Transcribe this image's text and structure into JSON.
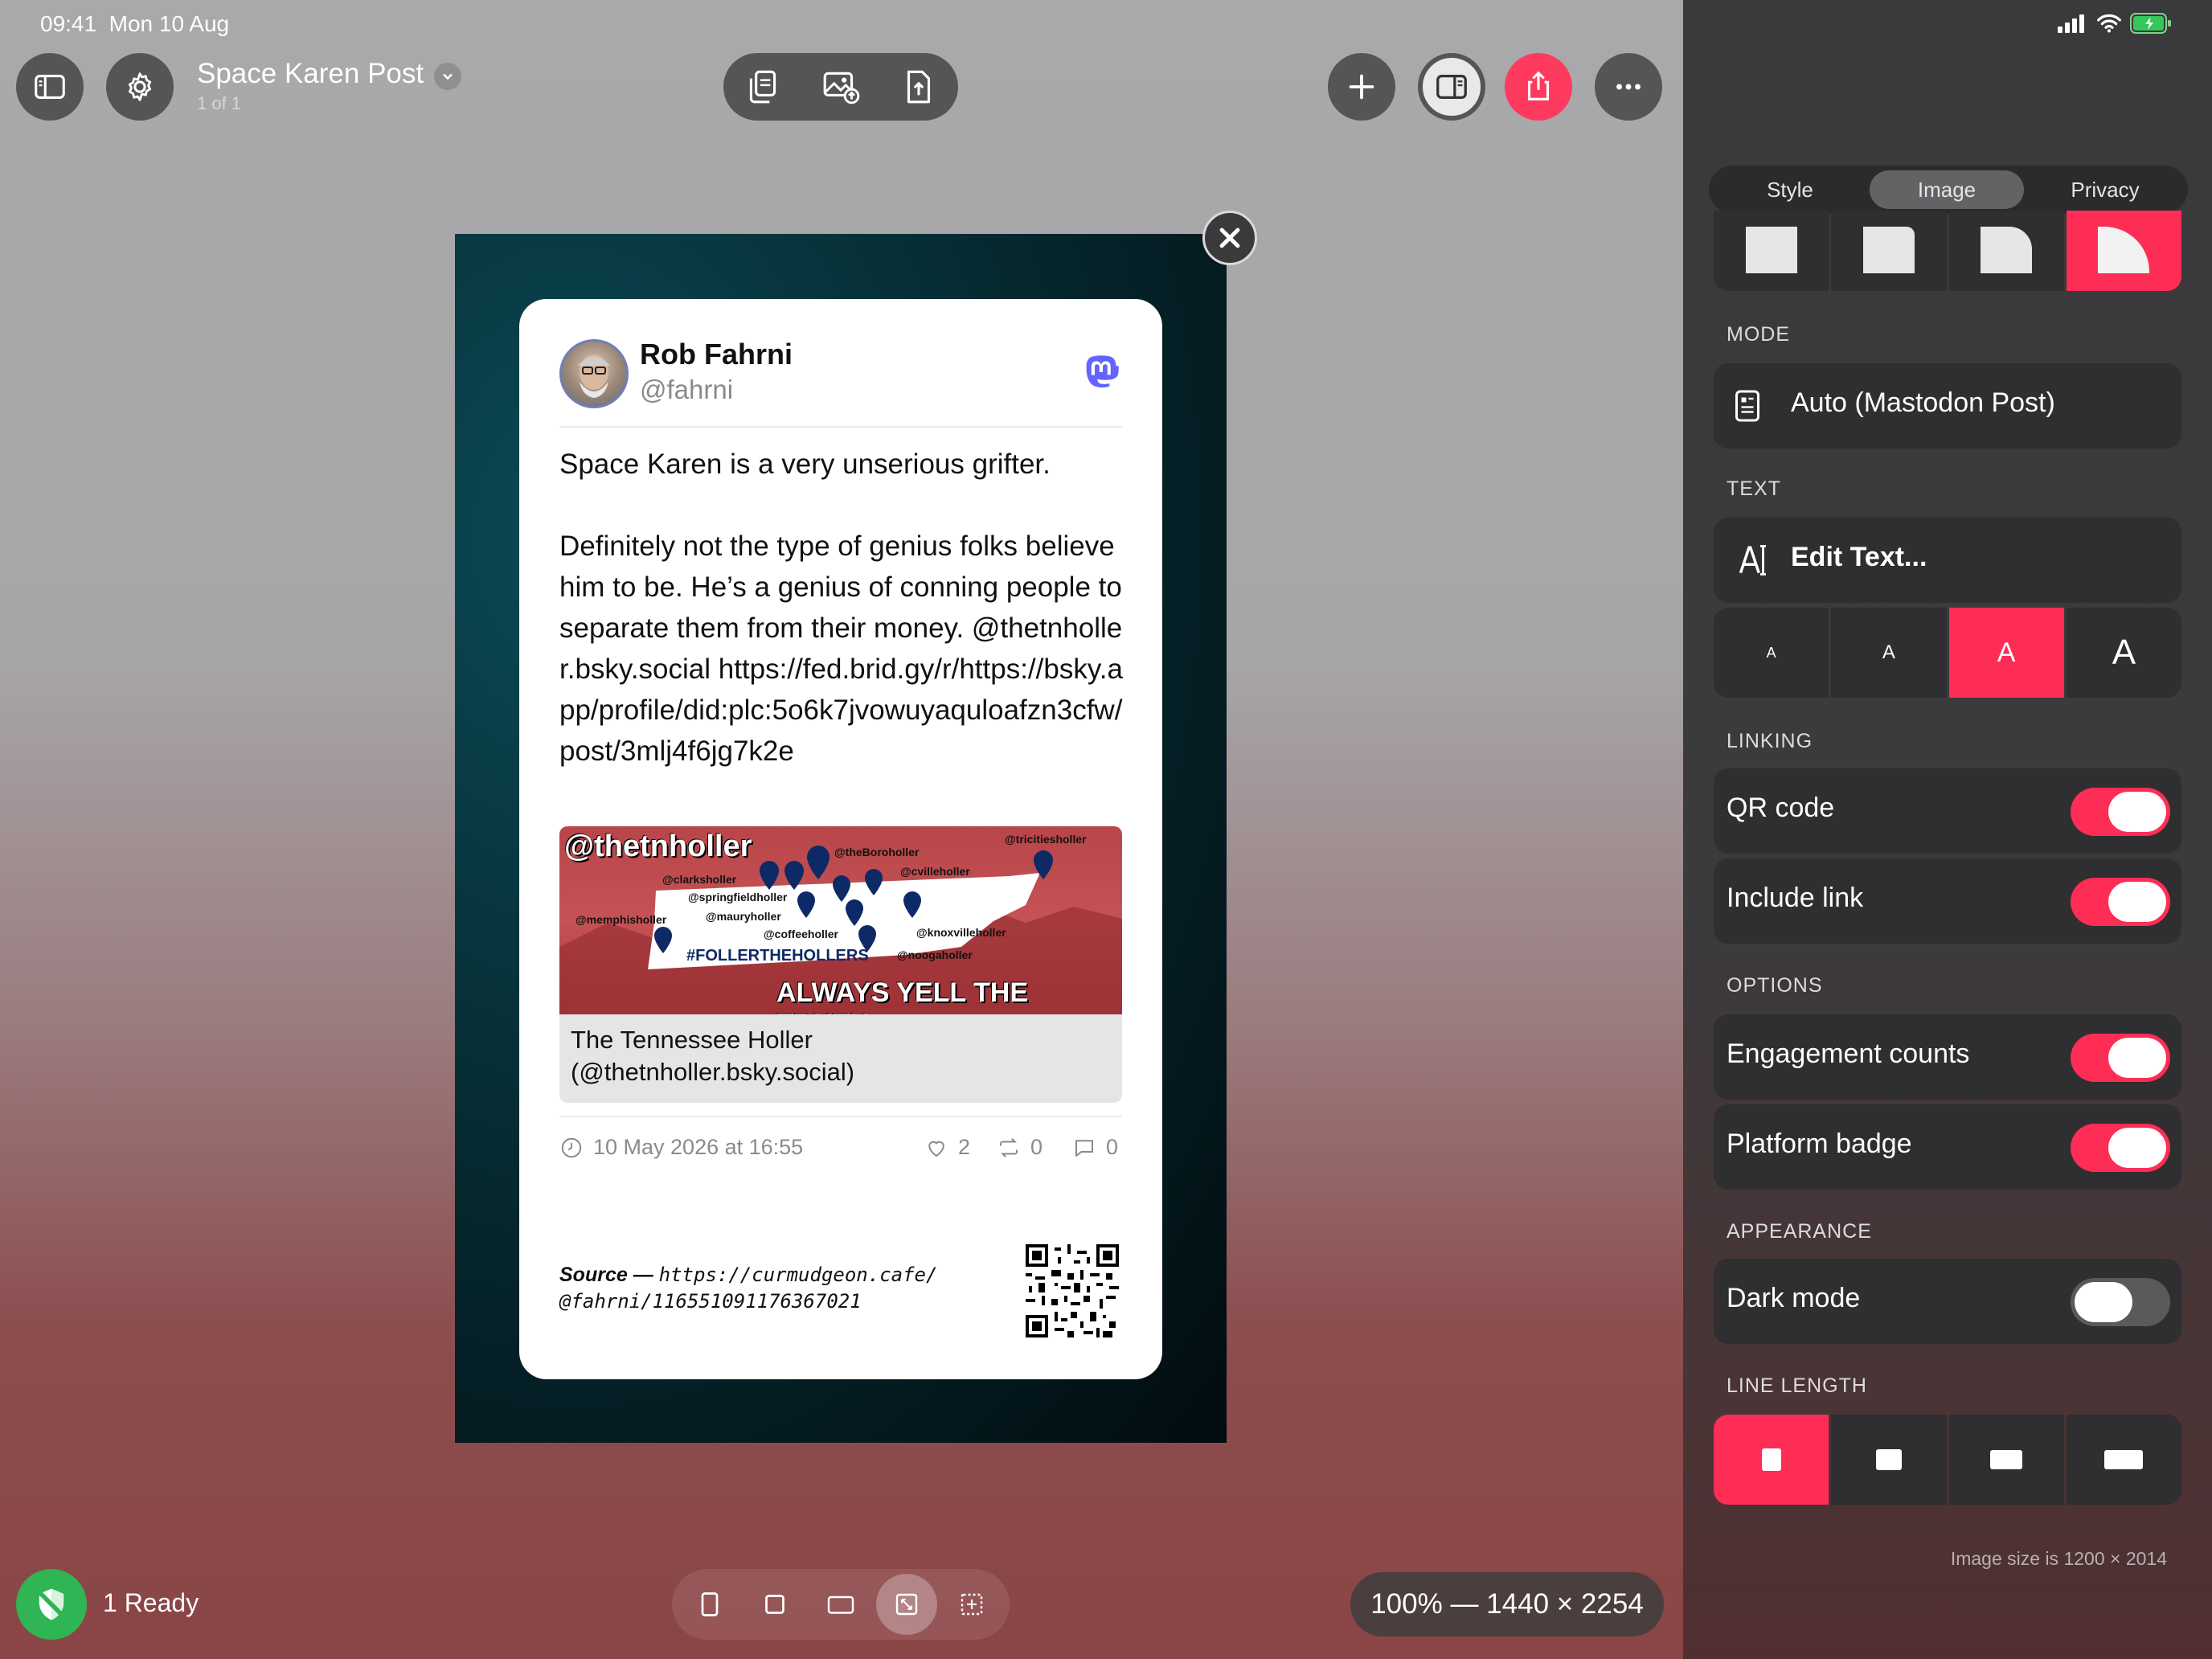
{
  "status_bar": {
    "time": "09:41",
    "date": "Mon 10 Aug"
  },
  "document": {
    "title": "Space Karen Post",
    "subtitle": "1 of 1"
  },
  "toolbar": {
    "left": [
      "sidebar-toggle-icon",
      "gear-icon"
    ],
    "center": [
      "copy-icon",
      "image-export-icon",
      "file-export-icon"
    ],
    "right": [
      "plus-icon",
      "split-view-icon",
      "share-icon",
      "more-icon"
    ],
    "accent": "#fe2d55"
  },
  "post": {
    "name": "Rob Fahrni",
    "handle": "@fahrni",
    "text": "Space Karen is a very unserious grifter.\n\nDefinitely not the type of genius folks believe him to be. He’s a genius of conning people to separate them from their money. @thetnholler.bsky.social https://fed.brid.gy/r/https://bsky.app/profile/did:plc:5o6k7jvowuyaquloafzn3cfw/post/3mlj4f6jg7k2e",
    "link_image": {
      "title": "@thetnholler",
      "tags": [
        "@clarksholler",
        "@springfieldholler",
        "@mauryholler",
        "@memphisholler",
        "@coffeeholler",
        "@theBoroholler",
        "@cvilleholler",
        "@knoxvilleholler",
        "@noogaholler",
        "@tricitiesholler"
      ],
      "hashtag": "#FOLLERTHEHOLLERS",
      "slogan": "ALWAYS YELL THE TRUTH"
    },
    "link_title": "The Tennessee Holler",
    "link_subtitle": "(@thetnholler.bsky.social)",
    "timestamp": "10 May 2026 at 16:55",
    "likes": "2",
    "reposts": "0",
    "replies": "0",
    "source_label": "Source —",
    "source_url_line1": "https://curmudgeon.cafe/",
    "source_url_line2": "@fahrni/116551091176367021"
  },
  "sidebar": {
    "tabs": [
      "Style",
      "Image",
      "Privacy"
    ],
    "active_tab": "Image",
    "mode_header": "MODE",
    "mode_value": "Auto (Mastodon Post)",
    "text_header": "TEXT",
    "edit_text": "Edit Text...",
    "text_sizes": [
      "A",
      "A",
      "A",
      "A"
    ],
    "linking_header": "LINKING",
    "qr_code": "QR code",
    "include_link": "Include link",
    "options_header": "OPTIONS",
    "engagement": "Engagement counts",
    "platform_badge": "Platform badge",
    "appearance_header": "APPEARANCE",
    "dark_mode": "Dark mode",
    "line_length_header": "LINE LENGTH",
    "image_size": "Image size is 1200 × 2014"
  },
  "bottom": {
    "ready": "1 Ready",
    "zoom": "100% — 1440 × 2254"
  }
}
